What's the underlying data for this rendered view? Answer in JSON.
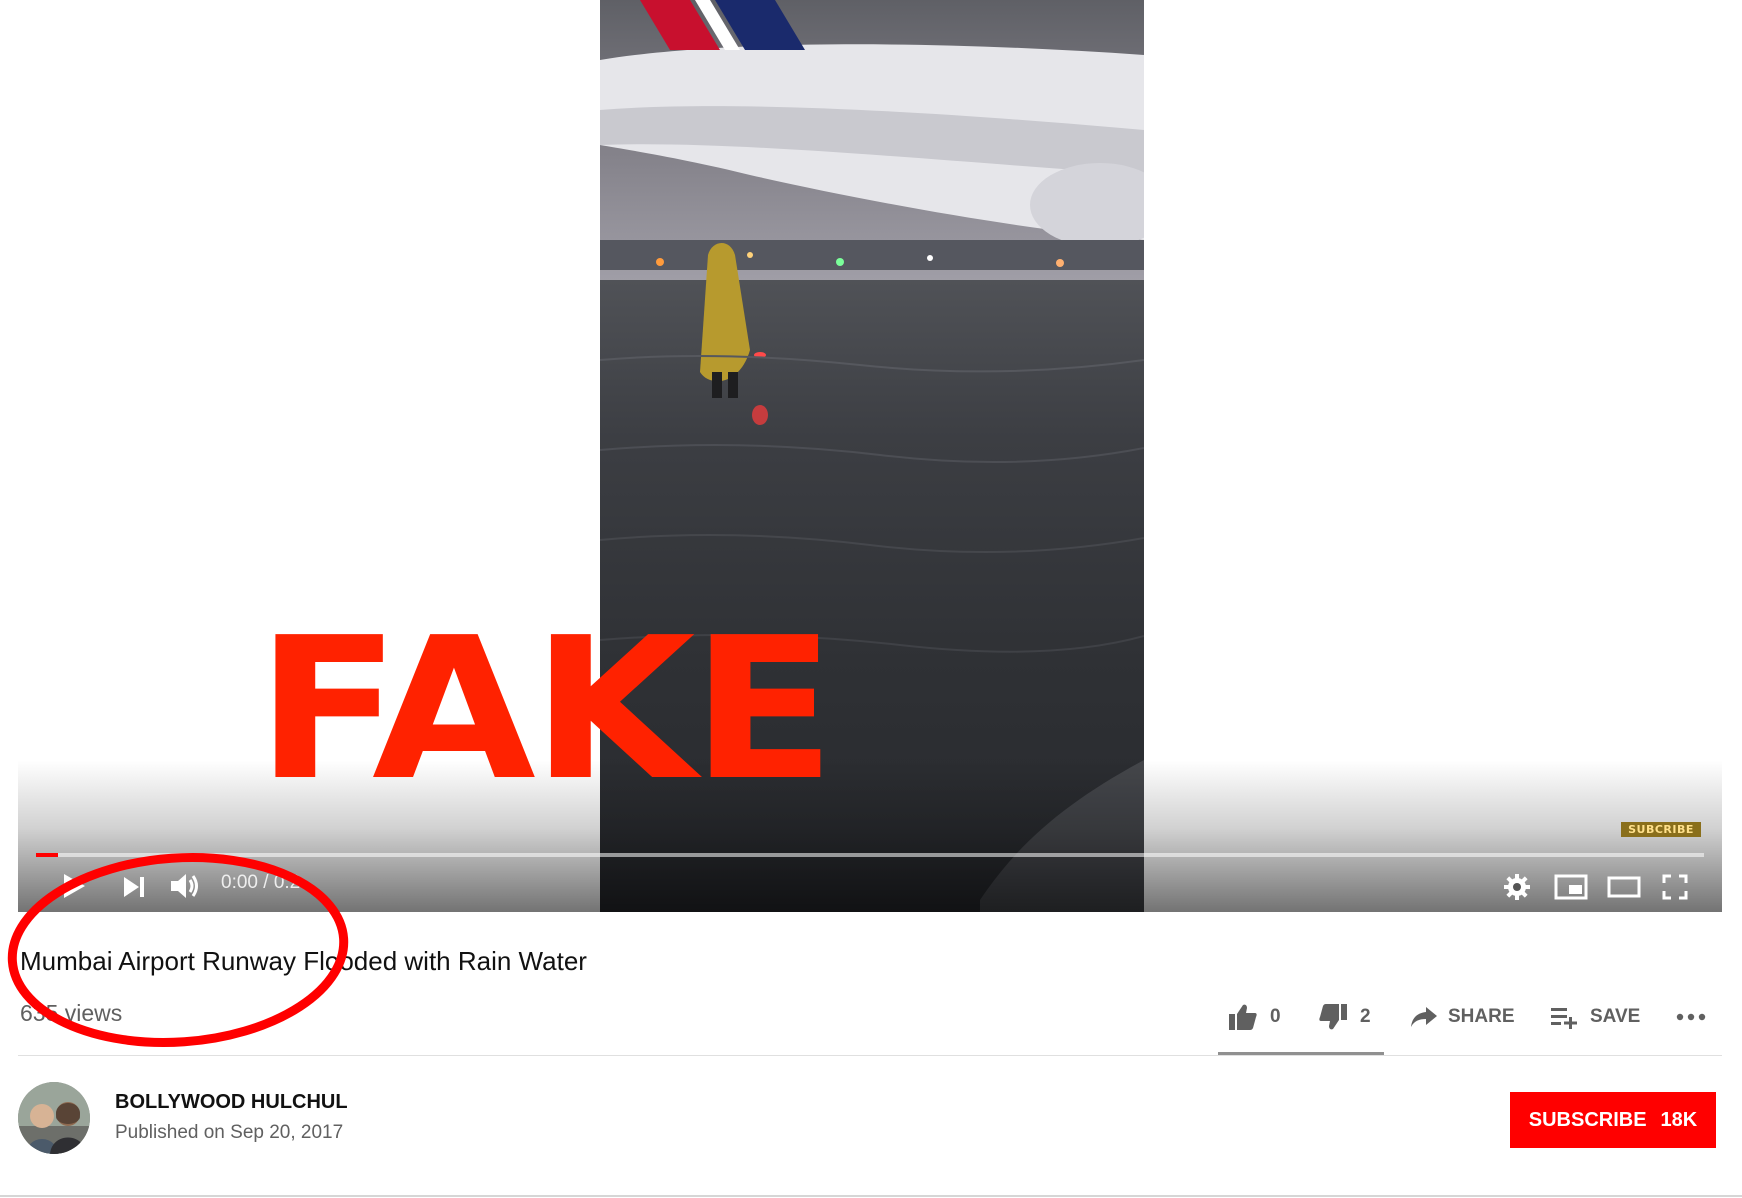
{
  "overlay": {
    "stamp_text": "FAKE",
    "stamp_color": "#ff2200",
    "circle_color": "#ff0000"
  },
  "player": {
    "time_display": "0:00 / 0:2",
    "progress_fraction": 0.013,
    "watermark_text": "SUBCRIBE",
    "icons": [
      "play-icon",
      "next-icon",
      "volume-icon",
      "settings-icon",
      "miniplayer-icon",
      "theater-icon",
      "fullscreen-icon"
    ]
  },
  "video": {
    "title": "Mumbai Airport Runway Flooded with Rain Water",
    "views": "635 views"
  },
  "actions": {
    "like_count": "0",
    "dislike_count": "2",
    "share_label": "SHARE",
    "save_label": "SAVE"
  },
  "channel": {
    "name": "BOLLYWOOD HULCHUL",
    "published": "Published on Sep 20, 2017",
    "subscribe_label": "SUBSCRIBE",
    "subscriber_count": "18K"
  },
  "colors": {
    "brand_red": "#ff0000",
    "text_primary": "#111111",
    "text_secondary": "#606060"
  }
}
